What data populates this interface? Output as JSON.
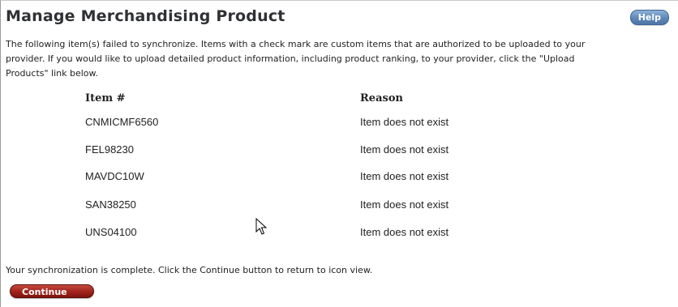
{
  "page": {
    "title": "Manage Merchandising Product",
    "help_label": "Help"
  },
  "intro": {
    "lines": [
      "The following item(s) failed to synchronize. Items with a check mark are custom items that are authorized to be uploaded to your",
      "provider. If you would like to upload detailed product information, including product ranking, to your provider, click the \"Upload",
      "Products\" link below."
    ]
  },
  "table": {
    "headers": {
      "item": "Item #",
      "reason": "Reason"
    },
    "rows": [
      {
        "item": "CNMICMF6560",
        "reason": "Item does not exist"
      },
      {
        "item": "FEL98230",
        "reason": "Item does not exist"
      },
      {
        "item": "MAVDC10W",
        "reason": "Item does not exist"
      },
      {
        "item": "SAN38250",
        "reason": "Item does not exist"
      },
      {
        "item": "UNS04100",
        "reason": "Item does not exist"
      }
    ]
  },
  "footer": {
    "message": "Your synchronization is complete. Click the Continue button to return to icon view.",
    "continue_label": "Continue"
  },
  "colors": {
    "help_button": "#5f88b8",
    "continue_button": "#a0231b",
    "text": "#222222"
  },
  "icons": {
    "cursor": "arrow-cursor-icon"
  }
}
